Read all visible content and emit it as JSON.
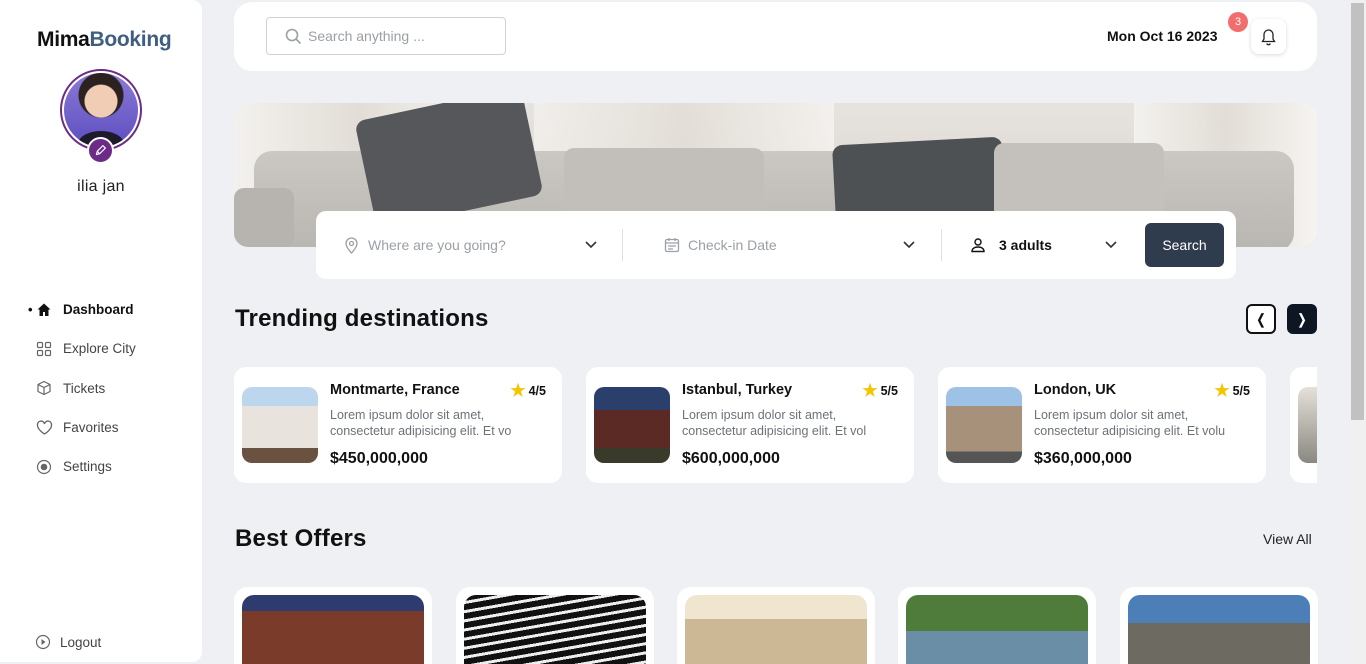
{
  "brand": {
    "part1": "Mima",
    "part2": "Booking"
  },
  "user": {
    "name": "ilia jan"
  },
  "sidebar": {
    "items": [
      {
        "label": "Dashboard",
        "icon": "home-icon",
        "active": true
      },
      {
        "label": "Explore City",
        "icon": "grid-icon"
      },
      {
        "label": "Tickets",
        "icon": "box-icon"
      },
      {
        "label": "Favorites",
        "icon": "heart-icon"
      },
      {
        "label": "Settings",
        "icon": "settings-icon"
      }
    ],
    "logout": "Logout"
  },
  "header": {
    "search_placeholder": "Search anything ...",
    "date": "Mon Oct 16 2023",
    "notifications": "3"
  },
  "booking": {
    "destination_placeholder": "Where are you going?",
    "checkin_placeholder": "Check-in Date",
    "guests": "3 adults",
    "search_label": "Search"
  },
  "trending": {
    "title": "Trending destinations",
    "cards": [
      {
        "name": "Montmarte, France",
        "rating": "4/5",
        "desc": "Lorem ipsum dolor sit amet, consectetur adipisicing elit. Et vo",
        "price": "$450,000,000"
      },
      {
        "name": "Istanbul, Turkey",
        "rating": "5/5",
        "desc": "Lorem ipsum dolor sit amet, consectetur adipisicing elit. Et vol",
        "price": "$600,000,000"
      },
      {
        "name": "London, UK",
        "rating": "5/5",
        "desc": "Lorem ipsum dolor sit amet, consectetur adipisicing elit. Et volu",
        "price": "$360,000,000"
      }
    ]
  },
  "offers": {
    "title": "Best Offers",
    "view_all": "View All"
  },
  "colors": {
    "accent_dark": "#2f3c4e",
    "brand_blue": "#3e5e82",
    "avatar_ring": "#6b2b86",
    "badge": "#f26d6d",
    "star": "#f6c500"
  }
}
